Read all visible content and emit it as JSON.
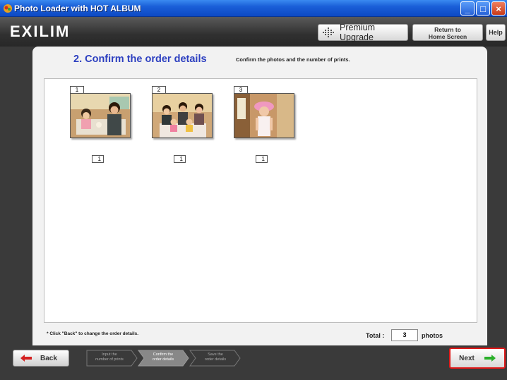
{
  "window": {
    "title": "Photo Loader with HOT ALBUM",
    "minimize": "_",
    "maximize": "□",
    "close": "×"
  },
  "header": {
    "logo_text": "EXILIM",
    "premium_upgrade_label": "Premium Upgrade",
    "return_home_line1": "Return to",
    "return_home_line2": "Home Screen",
    "help_label": "Help"
  },
  "main": {
    "step_title": "2. Confirm the order details",
    "step_description": "Confirm the photos and the number of prints.",
    "photos": [
      {
        "number": "1",
        "quantity": "1",
        "scene": "two children at a table in a kitchen"
      },
      {
        "number": "2",
        "quantity": "1",
        "scene": "family group in a living room"
      },
      {
        "number": "3",
        "quantity": "1",
        "scene": "girl wearing a pink hat indoors"
      }
    ],
    "note": "* Click \"Back\" to change the order details.",
    "total_label": "Total :",
    "total_value": "3",
    "total_unit": "photos"
  },
  "footer": {
    "back_label": "Back",
    "next_label": "Next",
    "steps": [
      {
        "line1": "Input the",
        "line2": "number of prints",
        "active": false
      },
      {
        "line1": "Confirm the",
        "line2": "order details",
        "active": true
      },
      {
        "line1": "Save the",
        "line2": "order details",
        "active": false
      }
    ]
  },
  "colors": {
    "title_bar": "#1a5fd8",
    "step_title": "#2c3fc0",
    "next_border": "#e01818",
    "back_arrow": "#d42020",
    "next_arrow": "#2ab02a"
  }
}
